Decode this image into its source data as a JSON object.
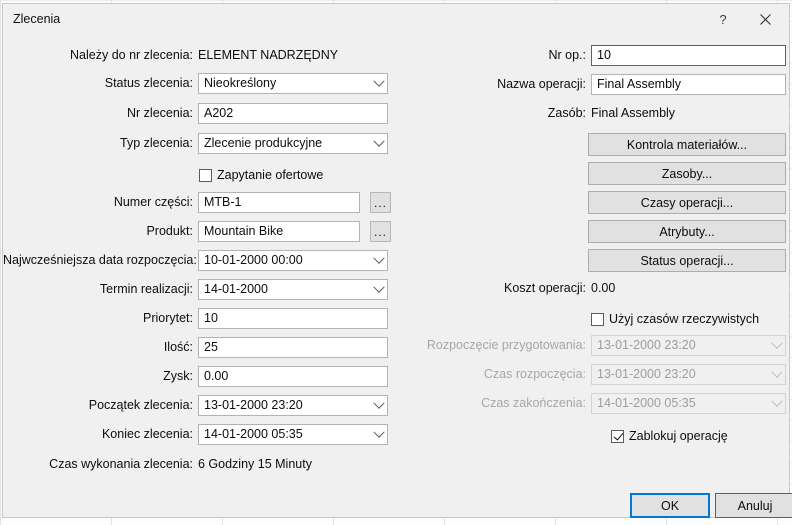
{
  "window": {
    "title": "Zlecenia",
    "help_icon": "question-mark-icon",
    "close_icon": "close-icon"
  },
  "left_column": {
    "parent_order": {
      "label": "Należy do nr zlecenia:",
      "value": "ELEMENT NADRZĘDNY"
    },
    "order_status": {
      "label": "Status zlecenia:",
      "value": "Nieokreślony"
    },
    "order_number": {
      "label": "Nr zlecenia:",
      "value": "A202"
    },
    "order_type": {
      "label": "Typ zlecenia:",
      "value": "Zlecenie produkcyjne"
    },
    "quotation_request": {
      "label": "Zapytanie ofertowe",
      "checked": false
    },
    "part_number": {
      "label": "Numer części:",
      "value": "MTB-1",
      "browse_label": "..."
    },
    "product": {
      "label": "Produkt:",
      "value": "Mountain Bike",
      "browse_label": "..."
    },
    "earliest_start": {
      "label": "Najwcześniejsza data rozpoczęcia:",
      "value": "10-01-2000 00:00"
    },
    "due_date": {
      "label": "Termin realizacji:",
      "value": "14-01-2000"
    },
    "priority": {
      "label": "Priorytet:",
      "value": "10"
    },
    "quantity": {
      "label": "Ilość:",
      "value": "25"
    },
    "profit": {
      "label": "Zysk:",
      "value": "0.00"
    },
    "order_start": {
      "label": "Początek zlecenia:",
      "value": "13-01-2000 23:20"
    },
    "order_end": {
      "label": "Koniec zlecenia:",
      "value": "14-01-2000 05:35"
    },
    "lead_time": {
      "label": "Czas wykonania zlecenia:",
      "value": "6 Godziny 15 Minuty"
    }
  },
  "right_column": {
    "operation_number": {
      "label": "Nr op.:",
      "value": "10",
      "focused": true
    },
    "operation_name": {
      "label": "Nazwa operacji:",
      "value": "Final Assembly"
    },
    "resource": {
      "label": "Zasób:",
      "value": "Final Assembly"
    },
    "operation_cost": {
      "label": "Koszt operacji:",
      "value": "0.00"
    },
    "use_real_times": {
      "label": "Użyj czasów rzeczywistych",
      "checked": false
    },
    "setup_start": {
      "label": "Rozpoczęcie przygotowania:",
      "value": "13-01-2000 23:20",
      "disabled": true
    },
    "start_time": {
      "label": "Czas rozpoczęcia:",
      "value": "13-01-2000 23:20",
      "disabled": true
    },
    "end_time": {
      "label": "Czas zakończenia:",
      "value": "14-01-2000 05:35",
      "disabled": true
    },
    "lock_operation": {
      "label": "Zablokuj operację",
      "checked": true
    }
  },
  "action_buttons": [
    {
      "label": "Kontrola materiałów..."
    },
    {
      "label": "Zasoby..."
    },
    {
      "label": "Czasy operacji..."
    },
    {
      "label": "Atrybuty..."
    },
    {
      "label": "Status operacji..."
    }
  ],
  "footer": {
    "ok_label": "OK",
    "cancel_label": "Anuluj"
  },
  "colors": {
    "accent": "#0078d7",
    "dialog_bg": "#f0f0f0",
    "field_bg": "#ffffff",
    "button_bg": "#e1e1e1",
    "disabled_text": "#9d9d9d"
  }
}
